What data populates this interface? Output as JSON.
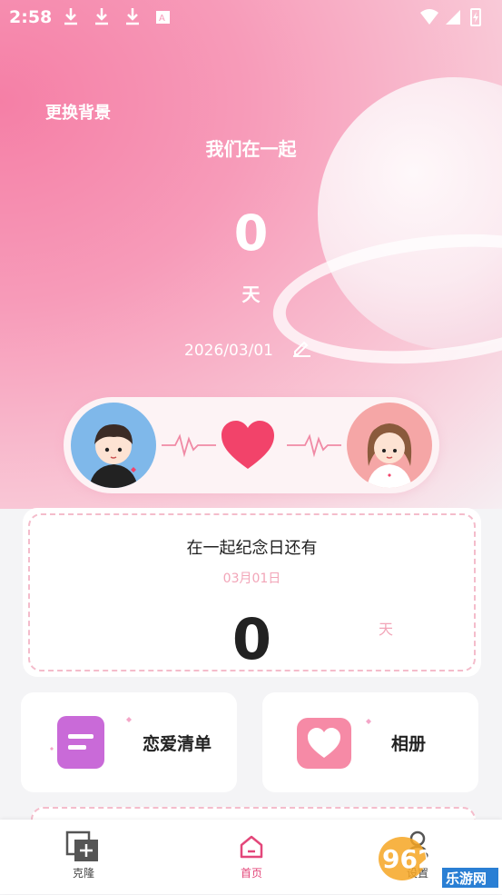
{
  "status_bar": {
    "time": "2:58",
    "left_icons": [
      "download-icon",
      "download-icon",
      "download-icon",
      "keyboard-icon"
    ],
    "right_icons": [
      "wifi-icon",
      "signal-icon",
      "battery-icon"
    ]
  },
  "hero": {
    "change_background": "更换背景",
    "together_label": "我们在一起",
    "days_count": "0",
    "days_unit": "天",
    "start_date": "2026/03/01"
  },
  "anniversary": {
    "title": "在一起纪念日还有",
    "date": "03月01日",
    "count": "0",
    "unit": "天"
  },
  "tiles": [
    {
      "label": "恋爱清单",
      "icon": "list-icon"
    },
    {
      "label": "相册",
      "icon": "heart-photo-icon"
    }
  ],
  "tabbar": [
    {
      "label": "克隆",
      "icon": "clone-icon",
      "active": false
    },
    {
      "label": "首页",
      "icon": "home-icon",
      "active": true
    },
    {
      "label": "设置",
      "icon": "profile-icon",
      "active": false
    }
  ],
  "watermark": {
    "brand": "962.NET",
    "site": "乐游网"
  },
  "colors": {
    "accent": "#e3477a",
    "pink_light": "#f2a5b8",
    "heart": "#f2436a"
  }
}
